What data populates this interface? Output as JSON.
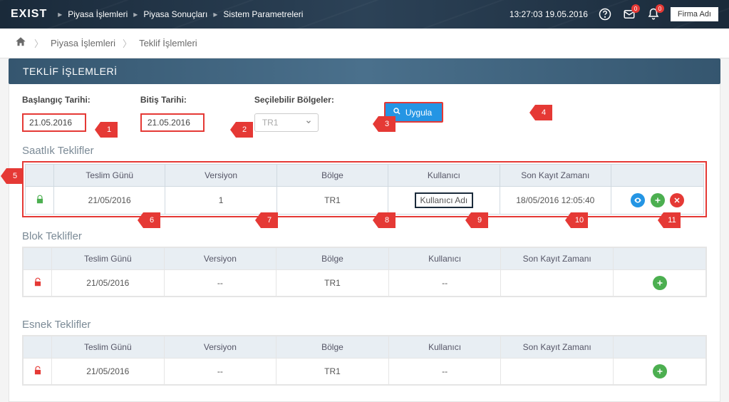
{
  "topbar": {
    "logo": "EXIST",
    "nav": [
      "Piyasa İşlemleri",
      "Piyasa Sonuçları",
      "Sistem Parametreleri"
    ],
    "datetime": "13:27:03 19.05.2016",
    "mail_badge": "0",
    "bell_badge": "0",
    "firm": "Firma Adı"
  },
  "breadcrumb": [
    "Piyasa İşlemleri",
    "Teklif İşlemleri"
  ],
  "page_title": "TEKLİF İŞLEMLERİ",
  "filters": {
    "start_label": "Başlangıç Tarihi:",
    "start_value": "21.05.2016",
    "end_label": "Bitiş Tarihi:",
    "end_value": "21.05.2016",
    "region_label": "Seçilebilir Bölgeler:",
    "region_value": "TR1",
    "apply_label": "Uygula"
  },
  "annotations": {
    "a1": "1",
    "a2": "2",
    "a3": "3",
    "a4": "4",
    "a5": "5",
    "a6": "6",
    "a7": "7",
    "a8": "8",
    "a9": "9",
    "a10": "10",
    "a11": "11"
  },
  "sections": {
    "hourly": {
      "title": "Saatlık Teklifler",
      "headers": [
        "Teslim Günü",
        "Versiyon",
        "Bölge",
        "Kullanıcı",
        "Son Kayıt Zamanı"
      ],
      "row": {
        "date": "21/05/2016",
        "version": "1",
        "region": "TR1",
        "user": "Kullanıcı Adı",
        "last": "18/05/2016 12:05:40"
      }
    },
    "block": {
      "title": "Blok Teklifler",
      "headers": [
        "Teslim Günü",
        "Versiyon",
        "Bölge",
        "Kullanıcı",
        "Son Kayıt Zamanı"
      ],
      "row": {
        "date": "21/05/2016",
        "version": "--",
        "region": "TR1",
        "user": "--",
        "last": ""
      }
    },
    "flex": {
      "title": "Esnek Teklifler",
      "headers": [
        "Teslim Günü",
        "Versiyon",
        "Bölge",
        "Kullanıcı",
        "Son Kayıt Zamanı"
      ],
      "row": {
        "date": "21/05/2016",
        "version": "--",
        "region": "TR1",
        "user": "--",
        "last": ""
      }
    }
  }
}
